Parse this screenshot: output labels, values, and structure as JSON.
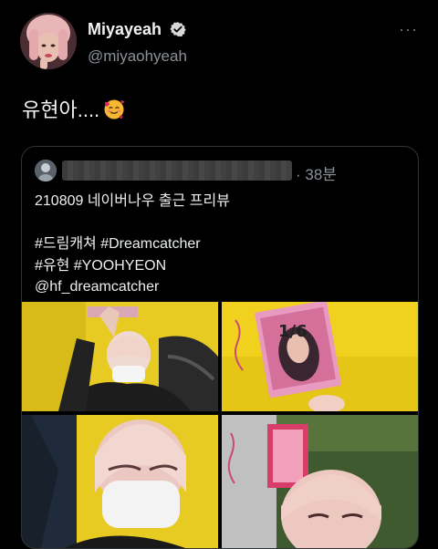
{
  "author": {
    "display_name": "Miyayeah",
    "handle": "@miyaohyeah",
    "verified": true
  },
  "menu": {
    "more_label": "···"
  },
  "tweet": {
    "text": "유현아....",
    "emoji": "🥰"
  },
  "quoted_tweet": {
    "time": "· 38분",
    "lines": [
      "210809 네이버나우 출근 프리뷰",
      "",
      "#드림캐쳐 #Dreamcatcher",
      "#유현 #YOOHYEON",
      "@hf_dreamcatcher"
    ],
    "photo_text": {
      "sign_text": "1/6"
    },
    "photos": [
      "photo-1",
      "photo-2",
      "photo-3",
      "photo-4"
    ]
  },
  "colors": {
    "background": "#000000",
    "verified": "#d8d8d8",
    "secondary_text": "#8b9197"
  }
}
